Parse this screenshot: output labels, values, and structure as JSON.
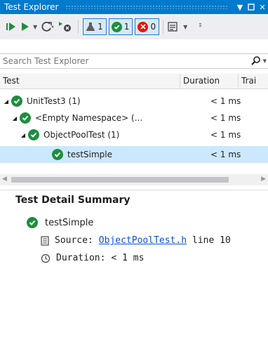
{
  "window": {
    "title": "Test Explorer"
  },
  "toolbar": {
    "counters": [
      {
        "icon": "flask-icon",
        "count": "1"
      },
      {
        "icon": "passed-icon",
        "count": "1"
      },
      {
        "icon": "failed-icon",
        "count": "0"
      }
    ]
  },
  "search": {
    "placeholder": "Search Test Explorer"
  },
  "columns": [
    "Test",
    "Duration",
    "Trai"
  ],
  "tree": [
    {
      "name": "UnitTest3 (1)",
      "duration": "< 1 ms"
    },
    {
      "name": "<Empty Namespace> (...",
      "duration": "< 1 ms"
    },
    {
      "name": "ObjectPoolTest (1)",
      "duration": "< 1 ms"
    },
    {
      "name": "testSimple",
      "duration": "< 1 ms"
    }
  ],
  "detail": {
    "title": "Test Detail Summary",
    "test_name": "testSimple",
    "source_label": "Source:",
    "source_link": "ObjectPoolTest.h",
    "source_line": "line 10",
    "duration_label": "Duration:",
    "duration_value": "< 1 ms"
  },
  "colors": {
    "accent": "#007acc",
    "passed": "#1e8e3e",
    "failed": "#e51400",
    "selected": "#cce8ff"
  }
}
